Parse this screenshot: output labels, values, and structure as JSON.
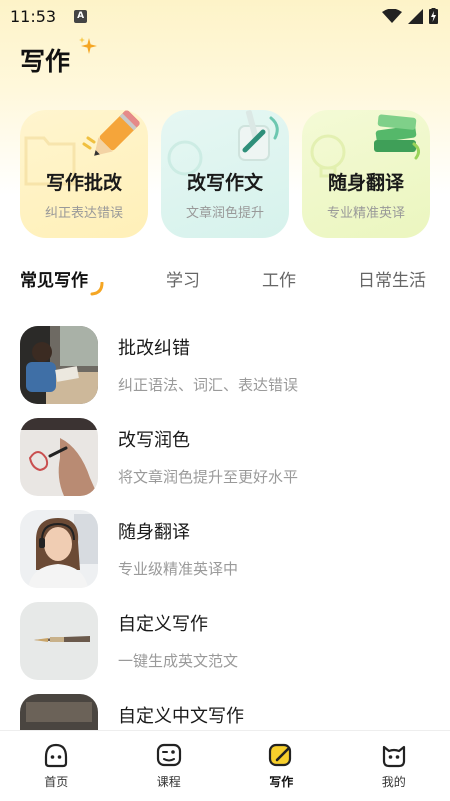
{
  "status_bar": {
    "time": "11:53",
    "notification_glyph": "A"
  },
  "header": {
    "title": "写作",
    "sparkle_icon": "sparkle-icon"
  },
  "feature_cards": [
    {
      "title": "写作批改",
      "subtitle": "纠正表达错误",
      "icon": "pencil-icon",
      "color": "#fff2c4"
    },
    {
      "title": "改写作文",
      "subtitle": "文章润色提升",
      "icon": "pen-holder-icon",
      "color": "#ddf3ee"
    },
    {
      "title": "随身翻译",
      "subtitle": "专业精准英译",
      "icon": "book-icon",
      "color": "#eef8c8"
    }
  ],
  "tabs": [
    {
      "label": "常见写作",
      "active": true
    },
    {
      "label": "学习",
      "active": false
    },
    {
      "label": "工作",
      "active": false
    },
    {
      "label": "日常生活",
      "active": false
    }
  ],
  "writing_list": [
    {
      "title": "批改纠错",
      "subtitle": "纠正语法、词汇、表达错误",
      "thumbnail": "student-at-desk"
    },
    {
      "title": "改写润色",
      "subtitle": "将文章润色提升至更好水平",
      "thumbnail": "hand-drawing"
    },
    {
      "title": "随身翻译",
      "subtitle": "专业级精准英译中",
      "thumbnail": "woman-headset"
    },
    {
      "title": "自定义写作",
      "subtitle": "一键生成英文范文",
      "thumbnail": "fountain-pen"
    },
    {
      "title": "自定义中文写作",
      "subtitle": "",
      "thumbnail": "dark-photo"
    }
  ],
  "bottom_nav": [
    {
      "label": "首页",
      "icon": "home-face-icon",
      "active": false
    },
    {
      "label": "课程",
      "icon": "course-face-icon",
      "active": false
    },
    {
      "label": "写作",
      "icon": "write-icon",
      "active": true
    },
    {
      "label": "我的",
      "icon": "cat-face-icon",
      "active": false
    }
  ],
  "colors": {
    "accent_yellow": "#f5c518",
    "accent_orange": "#f0a020",
    "nav_active_bg": "#f7cf2c"
  }
}
